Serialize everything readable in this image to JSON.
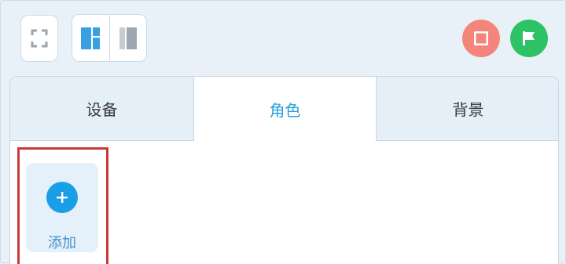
{
  "tabs": {
    "devices": "设备",
    "sprites": "角色",
    "backgrounds": "背景"
  },
  "sprite_panel": {
    "add_label": "添加"
  },
  "colors": {
    "accent": "#29a0dc",
    "stop": "#f5857a",
    "go": "#2ec267",
    "add": "#1a9ee6",
    "highlight": "#c9383a"
  },
  "icons": {
    "fullscreen": "fullscreen-icon",
    "layout_split": "layout-split-icon",
    "layout_single": "layout-single-icon",
    "stop": "stop-icon",
    "flag": "flag-icon",
    "plus": "plus-icon"
  }
}
